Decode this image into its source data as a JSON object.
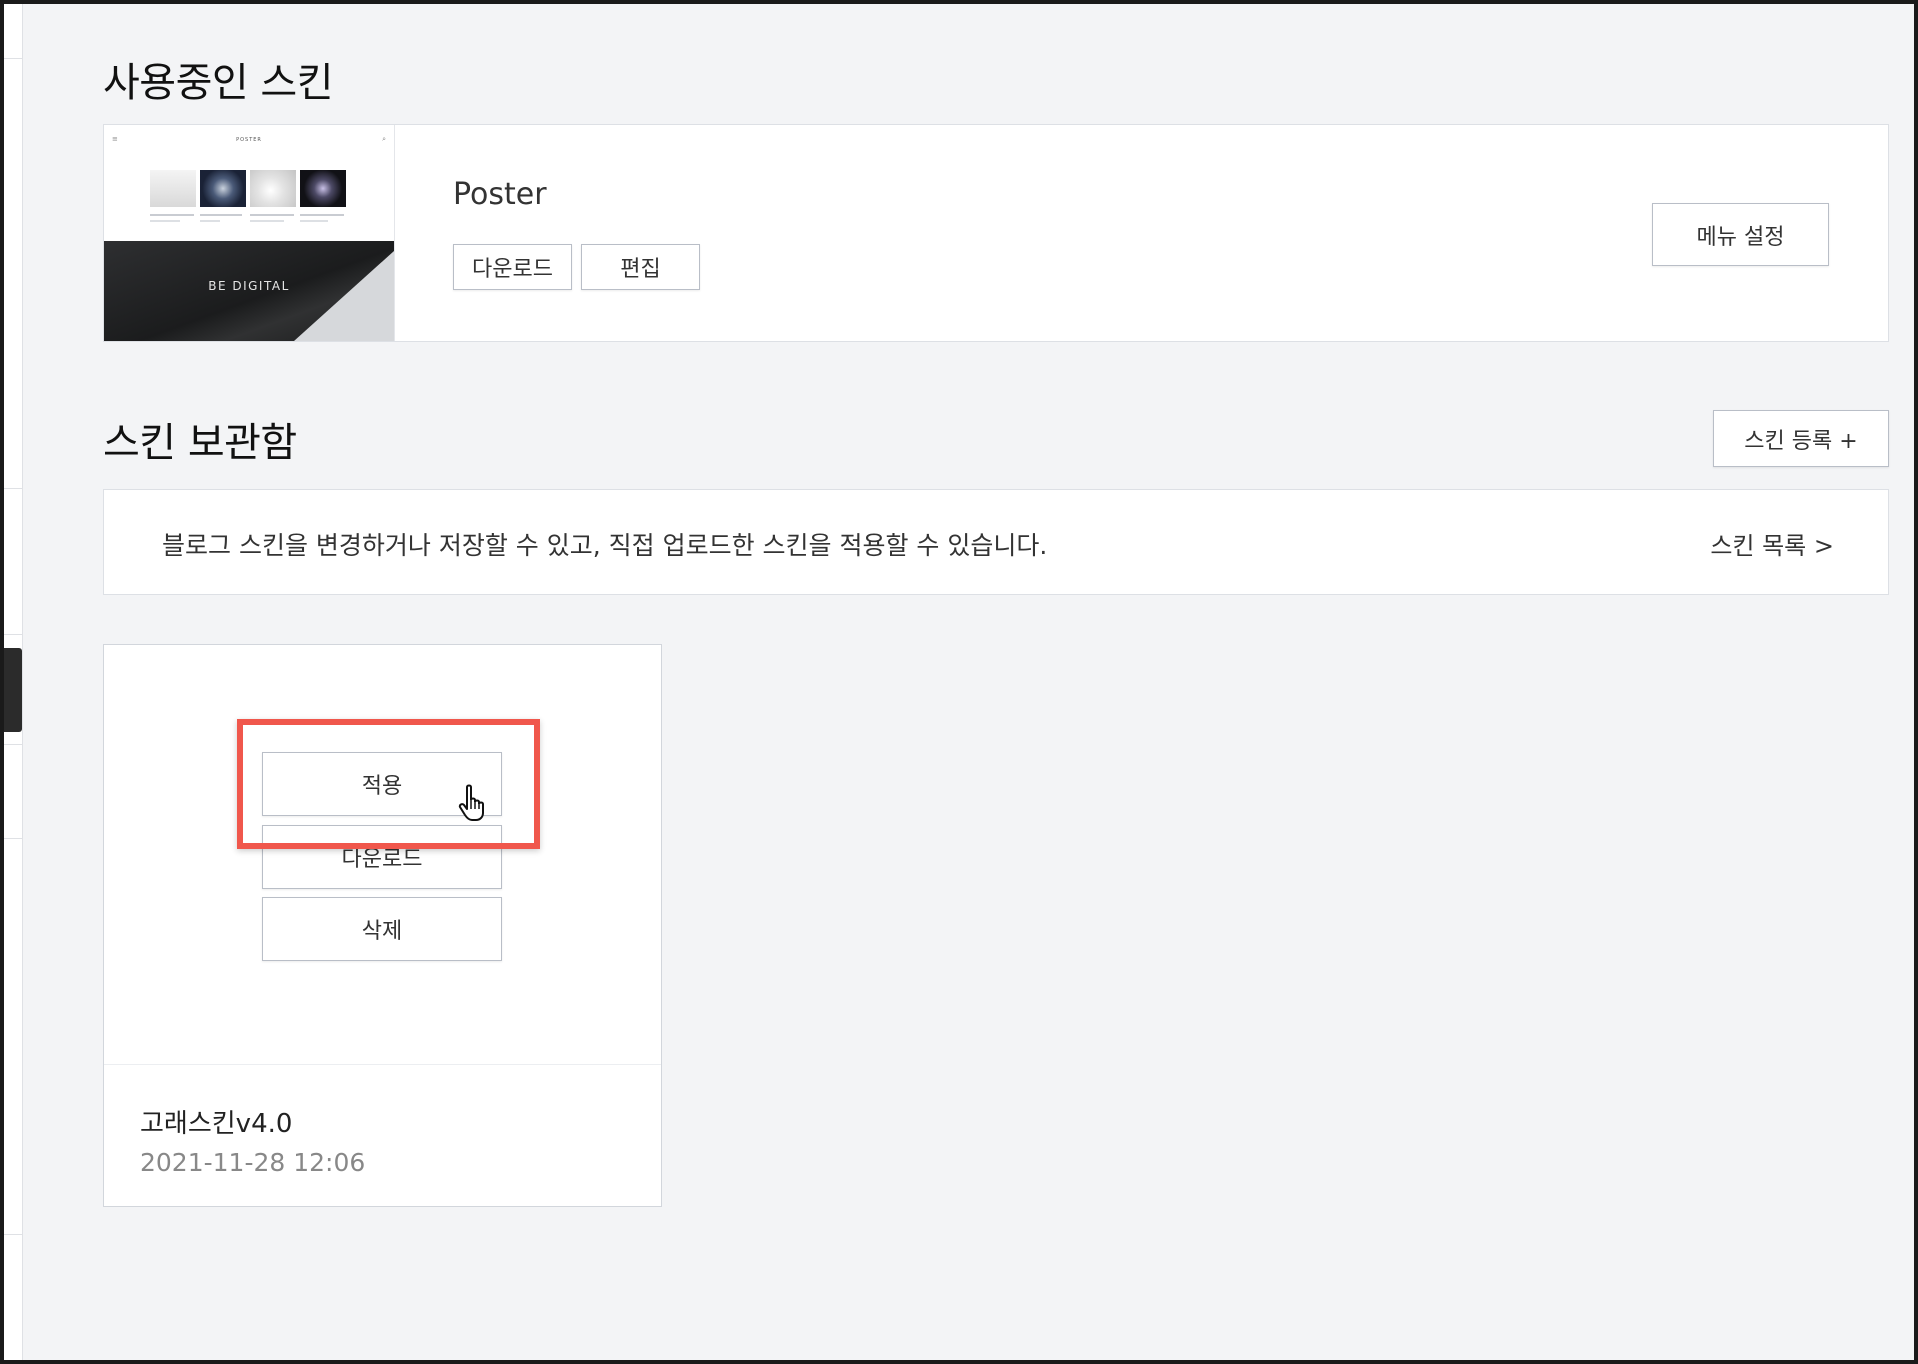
{
  "current_section": {
    "title": "사용중인 스킨",
    "skin_name": "Poster",
    "download_label": "다운로드",
    "edit_label": "편집",
    "menu_settings_label": "메뉴 설정",
    "thumbnail": {
      "top_title": "POSTER",
      "banner_text": "BE DIGITAL"
    }
  },
  "storage_section": {
    "title": "스킨 보관함",
    "register_label": "스킨 등록 +",
    "notice_text": "블로그 스킨을 변경하거나 저장할 수 있고, 직접 업로드한 스킨을 적용할 수 있습니다.",
    "list_link_label": "스킨 목록 >"
  },
  "skin_card": {
    "apply_label": "적용",
    "download_label": "다운로드",
    "delete_label": "삭제",
    "name": "고래스킨v4.0",
    "date": "2021-11-28 12:06"
  },
  "colors": {
    "highlight": "#f0574c",
    "background": "#f3f4f6"
  }
}
